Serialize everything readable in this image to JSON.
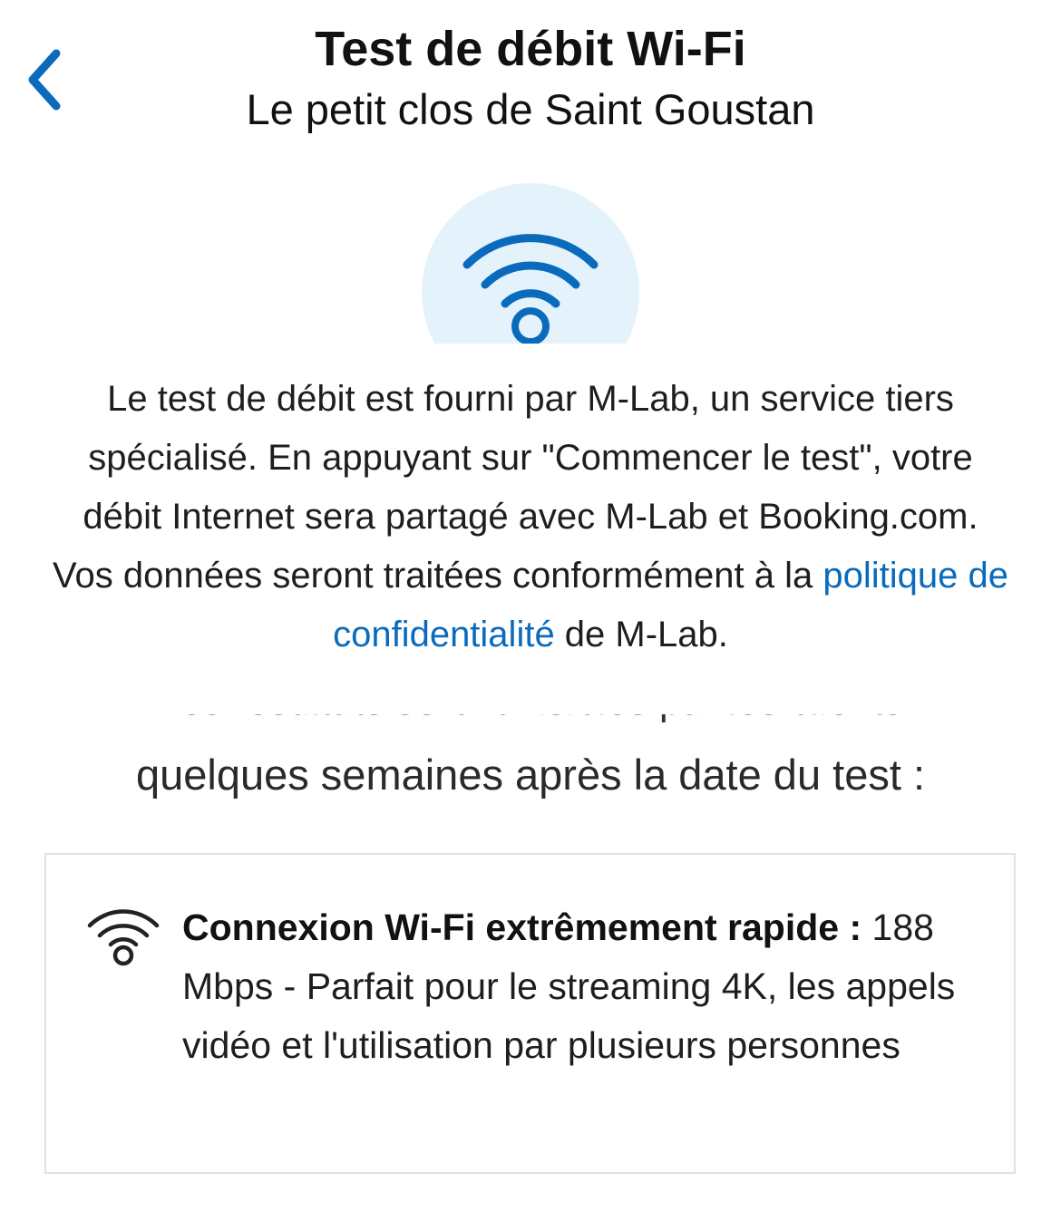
{
  "header": {
    "title": "Test de débit Wi-Fi",
    "subtitle": "Le petit clos de Saint Goustan"
  },
  "icons": {
    "back": "chevron-left-icon",
    "hero": "wifi-icon",
    "result": "wifi-icon"
  },
  "disclaimer": {
    "text_before_link": "Le test de débit est fourni par M-Lab, un service tiers spécialisé. En appuyant sur \"Commencer le test\", votre débit Internet sera partagé avec M-Lab et Booking.com. Vos données seront traitées conformément à la ",
    "link_label": "politique de confidentialité",
    "text_after_link": " de M-Lab."
  },
  "subheading": {
    "clipped_line": "Les résultats seront visibles par les clients",
    "text": "quelques semaines après la date du test :"
  },
  "result": {
    "label": "Connexion Wi-Fi extrêmement rapide :",
    "speed": "188 Mbps",
    "description": " - Parfait pour le streaming 4K, les appels vidéo et l'utilisation par plusieurs personnes"
  },
  "colors": {
    "accent": "#0a6bbd",
    "hero_background": "#e4f2fc",
    "card_border": "#e2e2e2",
    "text": "#1e1e1e"
  }
}
